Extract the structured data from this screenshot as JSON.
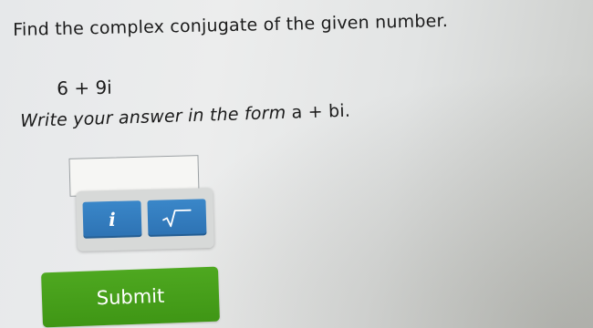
{
  "question": {
    "prompt": "Find the complex conjugate of the given number.",
    "number": "6 + 9i",
    "instruction_lead": "Write your answer in the form ",
    "instruction_form": "a + bi."
  },
  "answer": {
    "value": ""
  },
  "keypad": {
    "key_i_label": "i",
    "key_sqrt_icon": "sqrt-icon"
  },
  "actions": {
    "submit_label": "Submit"
  },
  "colors": {
    "key_blue": "#2f76b8",
    "submit_green": "#46a01a"
  }
}
